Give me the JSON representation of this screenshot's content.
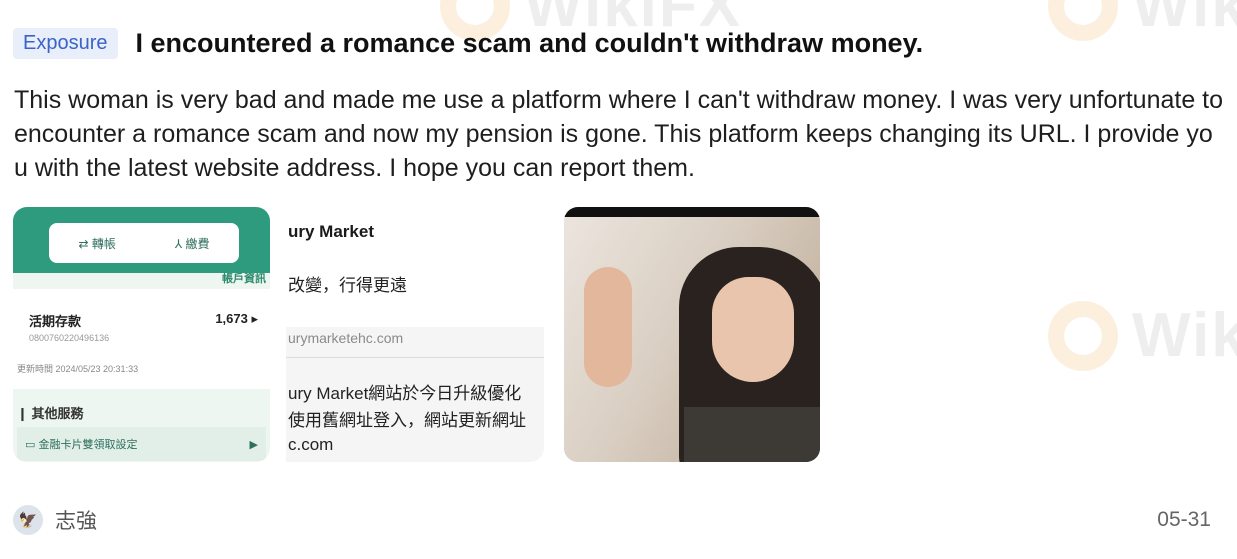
{
  "post": {
    "tag": "Exposure",
    "title": "I encountered a romance scam and couldn't withdraw money.",
    "body": "This woman is very bad and made me use a platform where I can't withdraw money. I was very unfortunate to encounter a romance scam and now my pension is gone. This platform keeps changing its URL. I provide you with the latest website address. I hope you can report them.",
    "author": "志強",
    "date": "05-31",
    "avatar_icon": "eagle-avatar-icon"
  },
  "watermark": {
    "text": "WikiFX",
    "color": "#f0a23a"
  },
  "images": {
    "app": {
      "tab1": "轉帳",
      "tab2": "繳費",
      "link": "帳戶資訊",
      "account_name": "活期存款",
      "account_number": "0800760220496136",
      "account_value": "1,673",
      "update_time": "更新時間  2024/05/23 20:31:33",
      "section": "其他服務",
      "setting": "金融卡片雙領取設定"
    },
    "message": {
      "name": "ury Market",
      "slogan": "改變，行得更遠",
      "url": "urymarketehc.com",
      "para_line1": "ury Market網站於今日升級優化",
      "para_line2": "使用舊網址登入，網站更新網址",
      "para_line3": "c.com"
    }
  }
}
